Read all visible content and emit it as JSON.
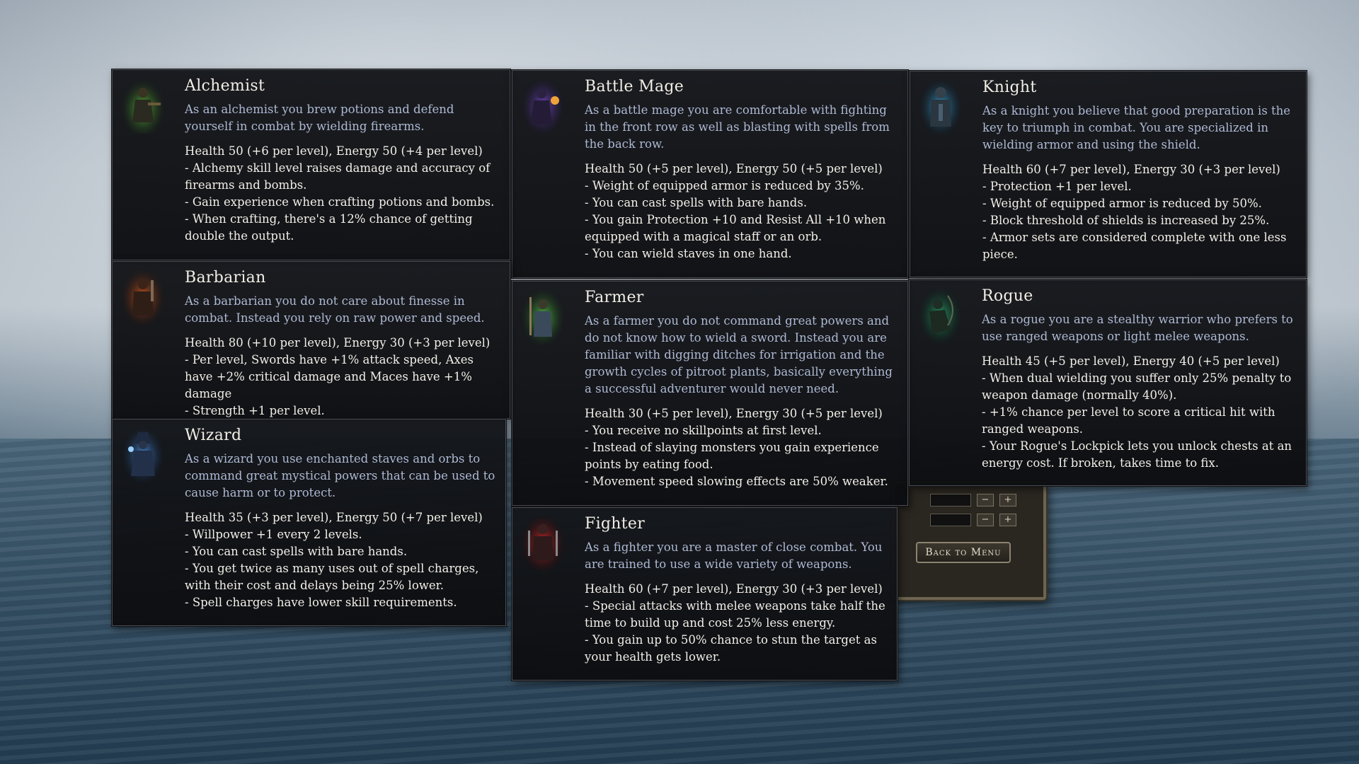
{
  "menu": {
    "back_label": "Back to Menu"
  },
  "colors": {
    "description_text": "#aeb9d3",
    "body_text": "#f3efe8",
    "panel_bg": "#14161a"
  },
  "classes": [
    {
      "name": "Alchemist",
      "icon": "alchemist-portrait-icon",
      "description": "As an alchemist you brew potions and defend yourself in combat by wielding firearms.",
      "stats": [
        "Health 50 (+6 per level), Energy 50 (+4 per level)",
        "- Alchemy skill level raises damage and accuracy of firearms and bombs.",
        "- Gain experience when crafting potions and bombs.",
        "- When crafting, there's a 12% chance of getting double the output."
      ]
    },
    {
      "name": "Battle Mage",
      "icon": "battle-mage-portrait-icon",
      "description": "As a battle mage you are comfortable with fighting in the front row as well as blasting with spells from the back row.",
      "stats": [
        "Health 50 (+5 per level), Energy 50 (+5 per level)",
        "- Weight of equipped armor is reduced by 35%.",
        "- You can cast spells with bare hands.",
        "- You gain Protection +10 and Resist All +10 when equipped with a magical staff or an orb.",
        "- You can wield staves in one hand."
      ]
    },
    {
      "name": "Knight",
      "icon": "knight-portrait-icon",
      "description": "As a knight you believe that good preparation is the key to triumph in combat. You are specialized in wielding armor and using the shield.",
      "stats": [
        "Health 60 (+7 per level), Energy 30 (+3 per level)",
        "- Protection +1 per level.",
        "- Weight of equipped armor is reduced by 50%.",
        "- Block threshold of shields is increased by 25%.",
        "- Armor sets are considered complete with one less piece."
      ]
    },
    {
      "name": "Barbarian",
      "icon": "barbarian-portrait-icon",
      "description": "As a barbarian you do not care about finesse in combat. Instead you rely on raw power and speed.",
      "stats": [
        "Health 80 (+10 per level), Energy 30 (+3 per level)",
        "- Per level, Swords have +1% attack speed, Axes have +2% critical damage and Maces have +1% damage",
        "- Strength +1 per level."
      ]
    },
    {
      "name": "Farmer",
      "icon": "farmer-portrait-icon",
      "description": "As a farmer you do not command great powers and do not know how to wield a sword. Instead you are familiar with digging ditches for irrigation and the growth cycles of pitroot plants, basically everything a successful adventurer would never need.",
      "stats": [
        "Health 30 (+5 per level), Energy 30 (+5 per level)",
        "- You receive no skillpoints at first level.",
        "- Instead of slaying monsters you gain experience points by eating food.",
        "- Movement speed slowing effects are 50% weaker."
      ]
    },
    {
      "name": "Rogue",
      "icon": "rogue-portrait-icon",
      "description": "As a rogue you are a stealthy warrior who prefers to use ranged weapons or light melee weapons.",
      "stats": [
        "Health 45 (+5 per level), Energy 40 (+5 per level)",
        "- When dual wielding you suffer only 25% penalty to weapon damage (normally 40%).",
        "- +1% chance per level to score a critical hit with ranged weapons.",
        "- Your Rogue's Lockpick lets you unlock chests at an energy cost. If broken, takes time to fix."
      ]
    },
    {
      "name": "Wizard",
      "icon": "wizard-portrait-icon",
      "description": "As a wizard you use enchanted staves and orbs to command great mystical powers that can be used to cause harm or to protect.",
      "stats": [
        "Health 35 (+3 per level), Energy 50 (+7 per level)",
        "- Willpower +1 every 2 levels.",
        "- You can cast spells with bare hands.",
        "- You get twice as many uses out of spell charges, with their cost and delays being 25% lower.",
        "- Spell charges have lower skill requirements."
      ]
    },
    {
      "name": "Fighter",
      "icon": "fighter-portrait-icon",
      "description": "As a fighter you are a master of close combat. You are trained to use a wide variety of weapons.",
      "stats": [
        "Health 60 (+7 per level), Energy 30 (+3 per level)",
        "- Special attacks with melee weapons take half the time to build up and cost 25% less energy.",
        "- You gain up to 50% chance to stun the target as your health gets lower."
      ]
    }
  ]
}
